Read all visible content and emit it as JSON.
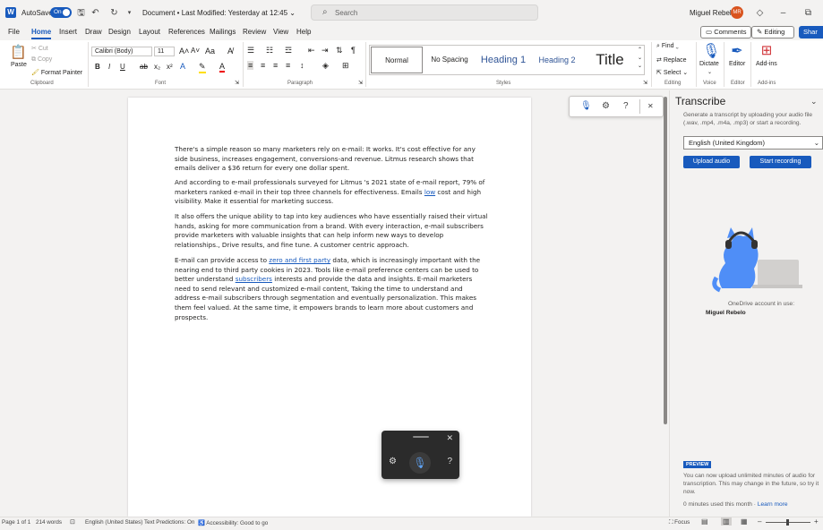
{
  "titlebar": {
    "app_icon": "word-logo",
    "autosave_label": "AutoSave",
    "autosave_state": "On",
    "doc_title": "Document • Last Modified: Yesterday at 12:45 ⌄",
    "search_placeholder": "Search",
    "user_name": "Miguel Rebelo",
    "user_initials": "MR"
  },
  "menu": {
    "tabs": [
      "File",
      "Home",
      "Insert",
      "Draw",
      "Design",
      "Layout",
      "References",
      "Mailings",
      "Review",
      "View",
      "Help"
    ],
    "comments_label": "Comments",
    "editing_label": "Editing ⌄",
    "share_label": "Shar"
  },
  "ribbon": {
    "clipboard": {
      "paste": "Paste",
      "cut": "Cut",
      "copy": "Copy",
      "format_painter": "Format Painter",
      "group": "Clipboard"
    },
    "font": {
      "name": "Calibri (Body)",
      "size": "11",
      "group": "Font"
    },
    "paragraph": {
      "group": "Paragraph"
    },
    "styles": {
      "items": [
        "Normal",
        "No Spacing",
        "Heading 1",
        "Heading 2",
        "Title"
      ],
      "group": "Styles"
    },
    "editing": {
      "find": "Find",
      "replace": "Replace",
      "select": "Select",
      "group": "Editing"
    },
    "voice": {
      "dictate": "Dictate",
      "group": "Voice"
    },
    "editor": {
      "label": "Editor",
      "group": "Editor"
    },
    "addins": {
      "label": "Add-ins",
      "group": "Add-ins"
    }
  },
  "document": {
    "p1": "There's a simple reason so many marketers rely on e-mail: It works. It's cost effective for any side business, increases engagement, conversions-and revenue. Litmus research shows that emails deliver a $36 return for every one dollar spent.",
    "p2a": "And according to e-mail professionals surveyed for Litmus 's 2021 state of e-mail report, 79% of marketers ranked e-mail in their top three channels for effectiveness. Emails ",
    "p2link": "low",
    "p2b": " cost and high visibility. Make it essential for marketing success.",
    "p3": "It also offers the unique ability to tap into key audiences who have essentially raised their virtual hands, asking for more communication from a brand. With every interaction, e-mail subscribers provide marketers with valuable insights that can help inform new ways to develop relationships., Drive results, and fine tune. A customer centric approach.",
    "p4a": "E-mail can provide access to ",
    "p4link1": "zero and first party",
    "p4b": " data, which is increasingly important with the nearing end to third party cookies in 2023. Tools like e-mail preference centers can be used to better understand ",
    "p4link2": "subscribers",
    "p4c": " interests and provide the data and insights. E-mail marketers need to send relevant and customized e-mail content, Taking the time to understand and address e-mail subscribers through segmentation and eventually personalization. This makes them feel valued. At the same time, it empowers brands to learn more about customers and prospects."
  },
  "transcribe": {
    "title": "Transcribe",
    "description": "Generate a transcript by uploading your audio file (.wav, .mp4, .m4a, .mp3) or start a recording.",
    "language": "English (United Kingdom)",
    "upload_label": "Upload audio",
    "record_label": "Start recording",
    "account_label": "OneDrive account in use:",
    "account_name": "Miguel Rebelo",
    "preview_badge": "PREVIEW",
    "preview_text": "You can now upload unlimited minutes of audio for transcription. This may change in the future, so try it now.",
    "minutes_used": "0 minutes used this month · ",
    "learn_more": "Learn more"
  },
  "statusbar": {
    "page": "Page 1 of 1",
    "words": "214 words",
    "language": "English (United States)",
    "predictions": "Text Predictions: On",
    "accessibility": "Accessibility: Good to go",
    "focus": "Focus"
  },
  "colors": {
    "accent": "#185abd",
    "avatar": "#d9531e"
  }
}
